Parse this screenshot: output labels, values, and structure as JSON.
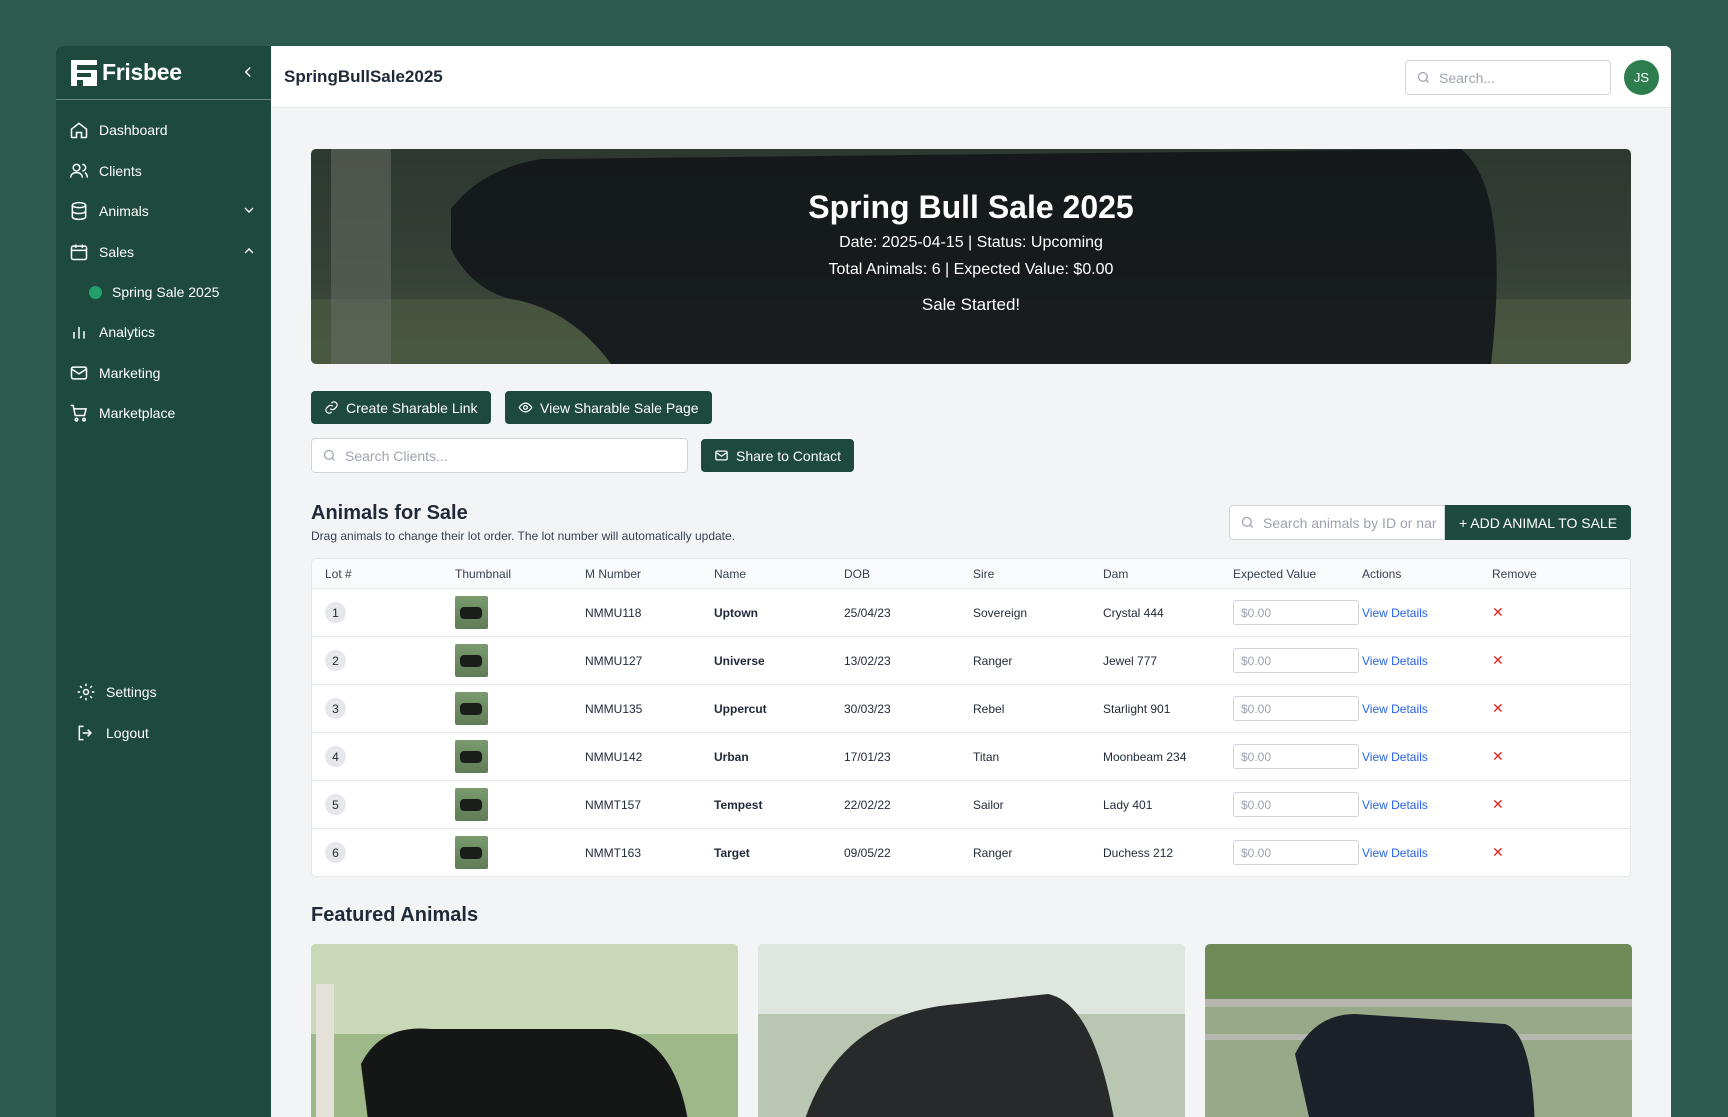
{
  "app": {
    "brand": "Frisbee",
    "page_title": "SpringBullSale2025",
    "search_placeholder": "Search...",
    "avatar_initials": "JS"
  },
  "sidebar": {
    "items": [
      {
        "label": "Dashboard",
        "icon": "home-icon"
      },
      {
        "label": "Clients",
        "icon": "users-icon"
      },
      {
        "label": "Animals",
        "icon": "database-icon"
      },
      {
        "label": "Sales",
        "icon": "calendar-icon"
      },
      {
        "label": "Spring Sale 2025",
        "icon": "status-dot"
      },
      {
        "label": "Analytics",
        "icon": "bar-chart-icon"
      },
      {
        "label": "Marketing",
        "icon": "mail-icon"
      },
      {
        "label": "Marketplace",
        "icon": "cart-icon"
      }
    ],
    "bottom": [
      {
        "label": "Settings",
        "icon": "gear-icon"
      },
      {
        "label": "Logout",
        "icon": "logout-icon"
      }
    ]
  },
  "hero": {
    "title": "Spring Bull Sale 2025",
    "line1": "Date: 2025-04-15 | Status: Upcoming",
    "line2": "Total Animals: 6 | Expected Value: $0.00",
    "status": "Sale Started!"
  },
  "actions": {
    "create_link": "Create Sharable Link",
    "view_page": "View Sharable Sale Page",
    "client_search_placeholder": "Search Clients...",
    "share_contact": "Share to Contact"
  },
  "animals": {
    "title": "Animals for Sale",
    "subtitle": "Drag animals to change their lot order. The lot number will automatically update.",
    "search_placeholder": "Search animals by ID or nar",
    "add_button": "+ ADD ANIMAL TO SALE",
    "columns": [
      "Lot #",
      "Thumbnail",
      "M Number",
      "Name",
      "DOB",
      "Sire",
      "Dam",
      "Expected Value",
      "Actions",
      "Remove"
    ],
    "rows": [
      {
        "lot": "1",
        "m_number": "NMMU118",
        "name": "Uptown",
        "dob": "25/04/23",
        "sire": "Sovereign",
        "dam": "Crystal 444",
        "value": "$0.00",
        "action": "View Details",
        "remove": "✕"
      },
      {
        "lot": "2",
        "m_number": "NMMU127",
        "name": "Universe",
        "dob": "13/02/23",
        "sire": "Ranger",
        "dam": "Jewel 777",
        "value": "$0.00",
        "action": "View Details",
        "remove": "✕"
      },
      {
        "lot": "3",
        "m_number": "NMMU135",
        "name": "Uppercut",
        "dob": "30/03/23",
        "sire": "Rebel",
        "dam": "Starlight 901",
        "value": "$0.00",
        "action": "View Details",
        "remove": "✕"
      },
      {
        "lot": "4",
        "m_number": "NMMU142",
        "name": "Urban",
        "dob": "17/01/23",
        "sire": "Titan",
        "dam": "Moonbeam 234",
        "value": "$0.00",
        "action": "View Details",
        "remove": "✕"
      },
      {
        "lot": "5",
        "m_number": "NMMT157",
        "name": "Tempest",
        "dob": "22/02/22",
        "sire": "Sailor",
        "dam": "Lady 401",
        "value": "$0.00",
        "action": "View Details",
        "remove": "✕"
      },
      {
        "lot": "6",
        "m_number": "NMMT163",
        "name": "Target",
        "dob": "09/05/22",
        "sire": "Ranger",
        "dam": "Duchess 212",
        "value": "$0.00",
        "action": "View Details",
        "remove": "✕"
      }
    ]
  },
  "featured": {
    "title": "Featured Animals"
  },
  "colors": {
    "sidebar": "#1e4a3d",
    "accent": "#1e4a3d",
    "link": "#2563eb",
    "remove": "#dc2626",
    "status_dot": "#22a06b"
  }
}
